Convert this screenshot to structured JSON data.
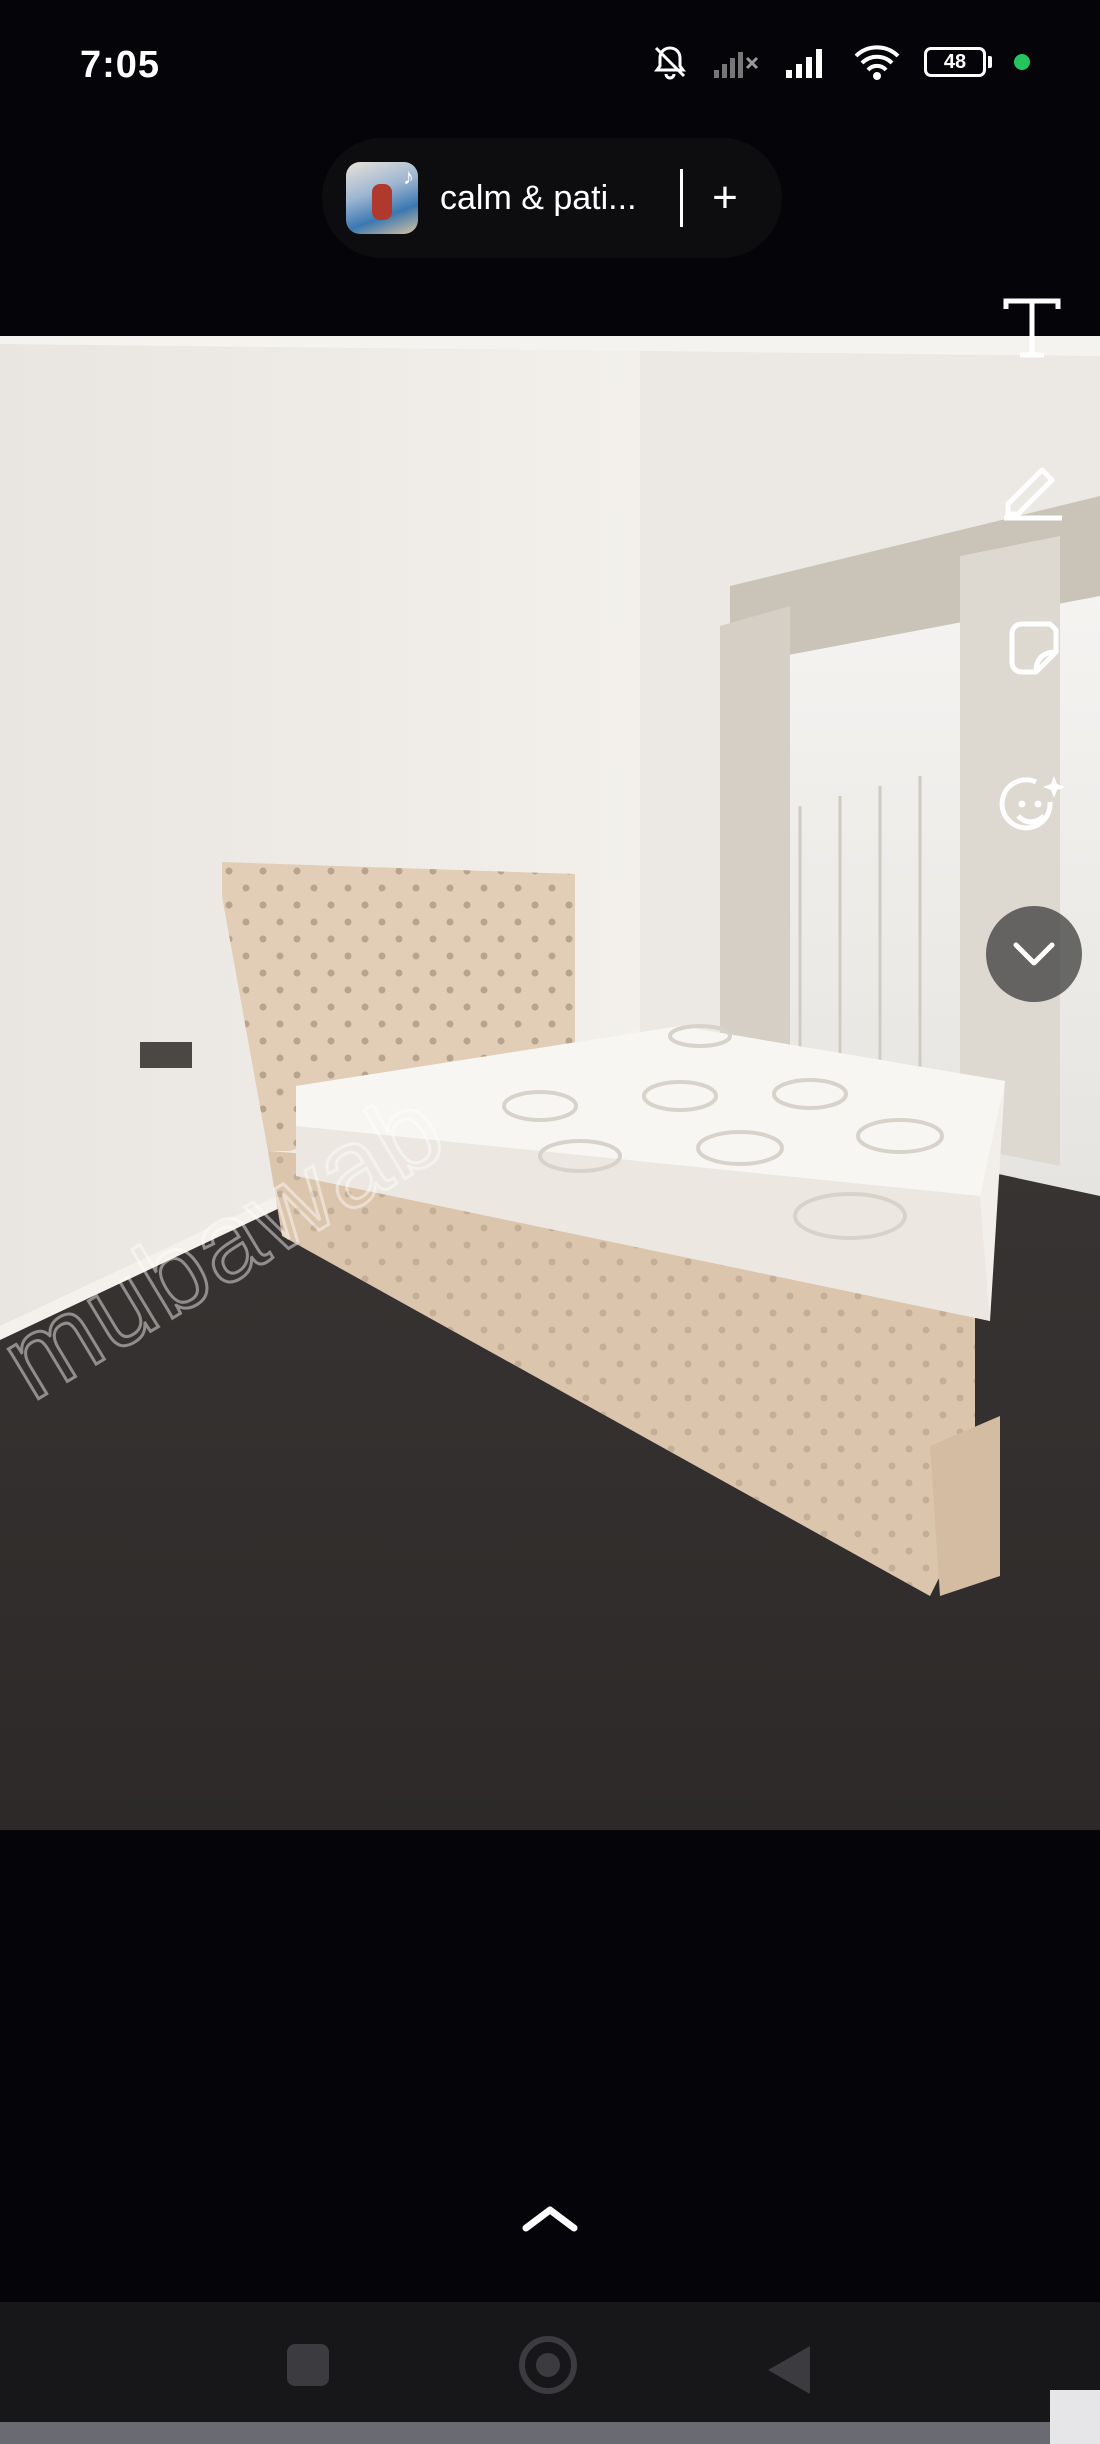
{
  "status_bar": {
    "time": "7:05",
    "battery_level": "48",
    "icons": [
      "notifications-off-icon",
      "signal-no-service-icon",
      "signal-icon",
      "wifi-icon",
      "battery-icon",
      "privacy-indicator-dot"
    ],
    "privacy_dot_color": "#22c55e"
  },
  "music": {
    "title": "calm & pati...",
    "add_label": "+",
    "album_art_icon": "music-note-icon"
  },
  "tools": [
    {
      "name": "text-tool",
      "label": "T"
    },
    {
      "name": "draw-tool",
      "icon": "pencil-icon"
    },
    {
      "name": "sticker-tool",
      "icon": "sticker-icon"
    },
    {
      "name": "effects-tool",
      "icon": "sparkle-smile-icon"
    },
    {
      "name": "collapse-tools",
      "icon": "chevron-down-icon"
    }
  ],
  "photo": {
    "watermark": "mubawab",
    "description_icon": "bedroom-photo"
  },
  "bottom": {
    "expand_icon": "chevron-up-icon"
  },
  "navigation": [
    "recents",
    "home",
    "back"
  ]
}
